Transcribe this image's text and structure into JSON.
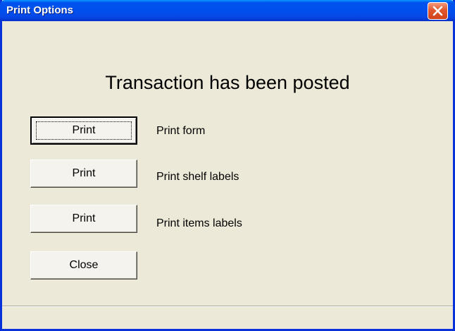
{
  "window": {
    "title": "Print Options",
    "close_icon": "close-icon"
  },
  "dialog": {
    "heading": "Transaction has been posted",
    "rows": [
      {
        "button_label": "Print",
        "description": "Print form"
      },
      {
        "button_label": "Print",
        "description": "Print shelf labels"
      },
      {
        "button_label": "Print",
        "description": "Print items labels"
      }
    ],
    "close_button_label": "Close"
  },
  "colors": {
    "titlebar": "#0053ee",
    "window_border": "#0831d9",
    "dialog_background": "#ece9d8",
    "close_button": "#e2572e"
  }
}
